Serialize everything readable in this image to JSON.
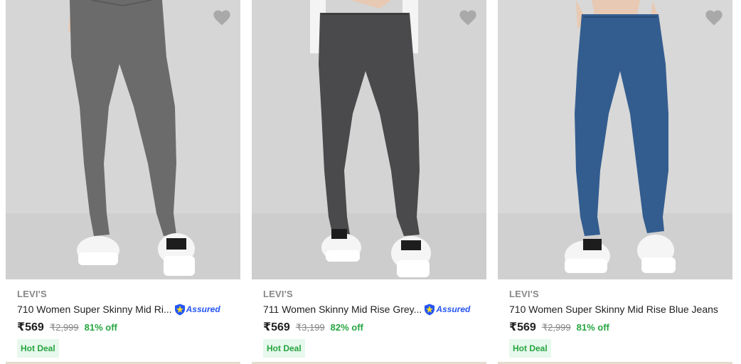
{
  "products": [
    {
      "brand": "LEVI'S",
      "title": "710 Women Super Skinny Mid Ri...",
      "assured": true,
      "assured_label": "Assured",
      "price": "₹569",
      "mrp": "₹2,999",
      "discount": "81% off",
      "deal": "Hot Deal",
      "jeans_color": "#6b6b6b"
    },
    {
      "brand": "LEVI'S",
      "title": "711 Women Skinny Mid Rise Grey...",
      "assured": true,
      "assured_label": "Assured",
      "price": "₹569",
      "mrp": "₹3,199",
      "discount": "82% off",
      "deal": "Hot Deal",
      "jeans_color": "#4a4a4c"
    },
    {
      "brand": "LEVI'S",
      "title": "710 Women Super Skinny Mid Rise Blue Jeans",
      "assured": false,
      "assured_label": "",
      "price": "₹569",
      "mrp": "₹2,999",
      "discount": "81% off",
      "deal": "Hot Deal",
      "jeans_color": "#335d8f"
    }
  ],
  "colors": {
    "discount_green": "#26a541",
    "assured_blue": "#2455f4",
    "wishlist_heart": "#a9a9a9"
  },
  "icons": {
    "wishlist": "heart-icon",
    "assured": "assured-shield-icon"
  }
}
